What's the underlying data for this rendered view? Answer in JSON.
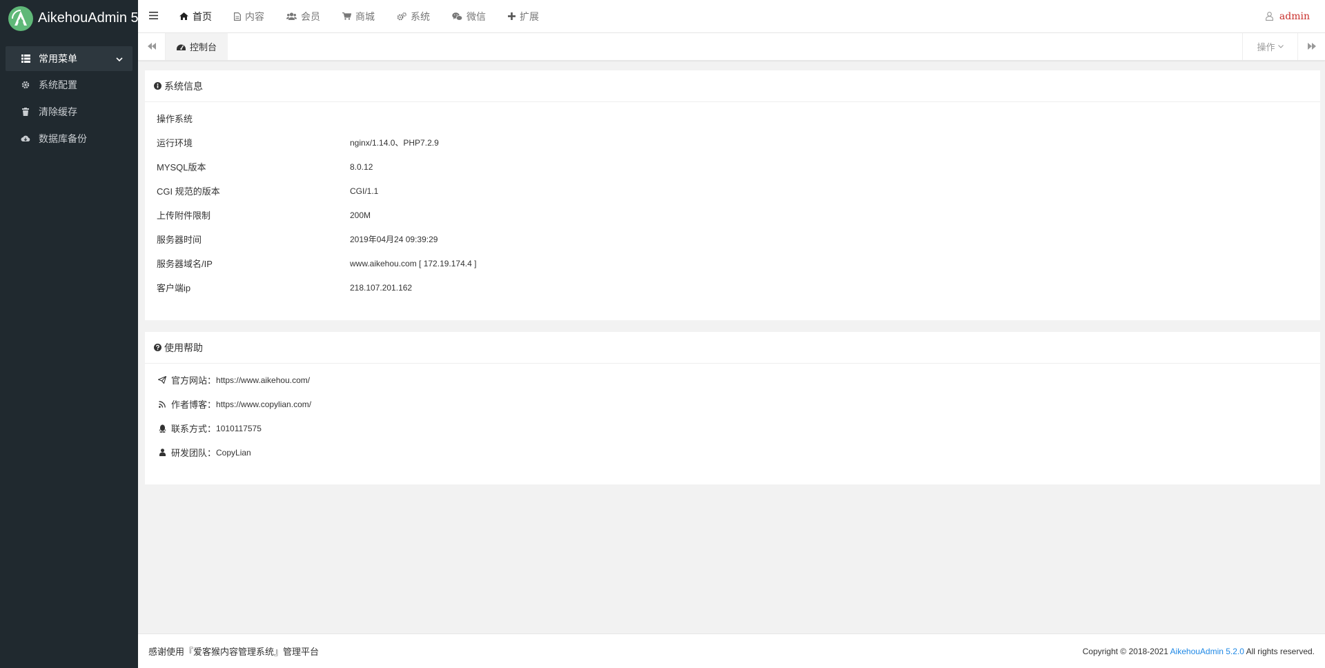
{
  "app": {
    "logo_text": "AikehouAdmin 5"
  },
  "sidebar": {
    "group_label": "常用菜单",
    "items": [
      {
        "label": "系统配置",
        "icon": "gear-icon"
      },
      {
        "label": "清除缓存",
        "icon": "trash-icon"
      },
      {
        "label": "数据库备份",
        "icon": "cloud-download-icon"
      }
    ]
  },
  "topnav": {
    "items": [
      {
        "label": "首页",
        "icon": "home-icon"
      },
      {
        "label": "内容",
        "icon": "file-icon"
      },
      {
        "label": "会员",
        "icon": "users-icon"
      },
      {
        "label": "商城",
        "icon": "cart-icon"
      },
      {
        "label": "系统",
        "icon": "cogs-icon"
      },
      {
        "label": "微信",
        "icon": "wechat-icon"
      },
      {
        "label": "扩展",
        "icon": "plus-icon"
      }
    ],
    "user": "admin"
  },
  "tabs": {
    "active": "控制台",
    "operations": "操作"
  },
  "system_info": {
    "title": "系统信息",
    "rows": [
      {
        "label": "操作系统",
        "value": ""
      },
      {
        "label": "运行环境",
        "value": "nginx/1.14.0、PHP7.2.9"
      },
      {
        "label": "MYSQL版本",
        "value": "8.0.12"
      },
      {
        "label": "CGI 规范的版本",
        "value": "CGI/1.1"
      },
      {
        "label": "上传附件限制",
        "value": "200M"
      },
      {
        "label": "服务器时间",
        "value": "2019年04月24 09:39:29"
      },
      {
        "label": "服务器域名/IP",
        "value": "www.aikehou.com [ 172.19.174.4 ]"
      },
      {
        "label": "客户端ip",
        "value": "218.107.201.162"
      }
    ]
  },
  "help": {
    "title": "使用帮助",
    "rows": [
      {
        "label": "官方网站：",
        "value": "https://www.aikehou.com/",
        "icon": "paper-plane-icon"
      },
      {
        "label": "作者博客：",
        "value": "https://www.copylian.com/",
        "icon": "rss-icon"
      },
      {
        "label": "联系方式：",
        "value": "1010117575",
        "icon": "qq-icon"
      },
      {
        "label": "研发团队：",
        "value": "CopyLian",
        "icon": "user-icon"
      }
    ]
  },
  "footer": {
    "left": "感谢使用『爱客猴内容管理系统』管理平台",
    "copyright": "Copyright © 2018-2021",
    "link": "AikehouAdmin 5.2.0",
    "rights": "All rights reserved."
  }
}
